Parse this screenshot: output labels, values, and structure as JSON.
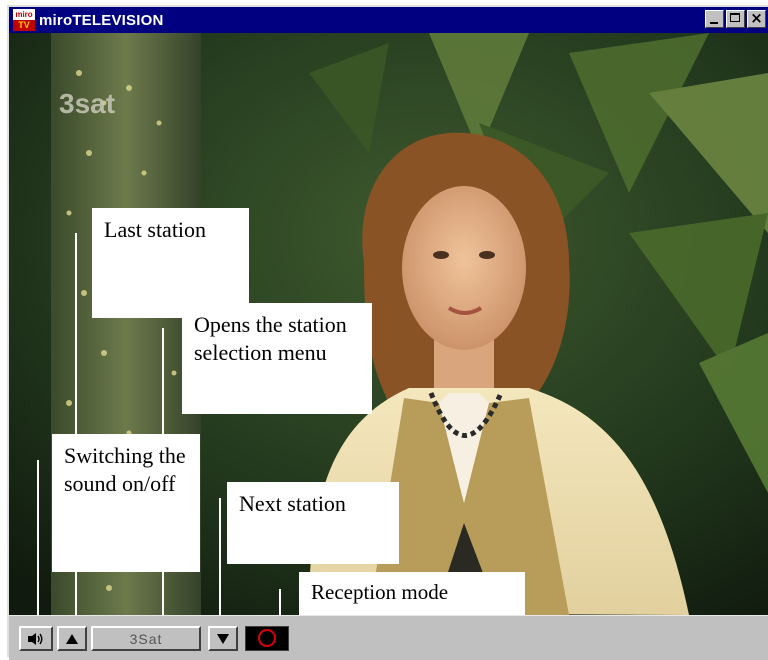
{
  "window": {
    "title": "miroTELEVISION",
    "icon_top": "miro",
    "icon_bottom": "TV"
  },
  "video": {
    "channel_logo": "3sat"
  },
  "callouts": {
    "last_station": "Last station",
    "station_menu": "Opens the station selection menu",
    "sound": "Switching the sound on/off",
    "next_station": "Next station",
    "reception_mode": "Reception mode"
  },
  "toolbar": {
    "sound_icon": "speaker-icon",
    "prev_icon": "triangle-up-icon",
    "station_value": "3Sat",
    "next_icon": "triangle-down-icon",
    "reception_icon": "red-circle-icon"
  },
  "colors": {
    "titlebar": "#000080",
    "chrome": "#c0c0c0",
    "reception_ring": "#e00000"
  }
}
